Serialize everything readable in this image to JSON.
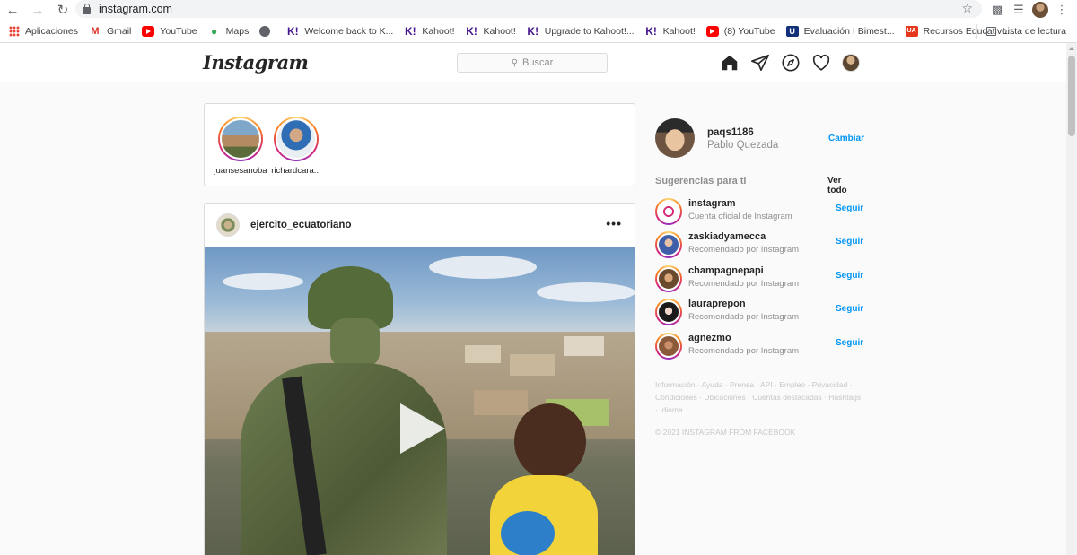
{
  "browser": {
    "url": "instagram.com",
    "bookmarks": [
      {
        "label": "Aplicaciones",
        "icon": "apps-grid-icon"
      },
      {
        "label": "Gmail",
        "icon": "gmail-icon"
      },
      {
        "label": "YouTube",
        "icon": "youtube-icon"
      },
      {
        "label": "Maps",
        "icon": "maps-icon"
      },
      {
        "label": "",
        "icon": "globe-icon"
      },
      {
        "label": "Welcome back to K...",
        "icon": "kahoot-icon"
      },
      {
        "label": "Kahoot!",
        "icon": "kahoot-icon"
      },
      {
        "label": "Kahoot!",
        "icon": "kahoot-icon"
      },
      {
        "label": "Upgrade to Kahoot!...",
        "icon": "kahoot-icon"
      },
      {
        "label": "Kahoot!",
        "icon": "kahoot-icon"
      },
      {
        "label": "(8) YouTube",
        "icon": "youtube-icon"
      },
      {
        "label": "Evaluación I Bimest...",
        "icon": "u-icon"
      },
      {
        "label": "Recursos Educativo...",
        "icon": "ua-icon"
      }
    ],
    "reading_list": "Lista de lectura"
  },
  "header": {
    "logo": "Instagram",
    "search_placeholder": "Buscar"
  },
  "stories": [
    {
      "name": "juansesanoba"
    },
    {
      "name": "richardcara..."
    }
  ],
  "post": {
    "username": "ejercito_ecuatoriano",
    "more": "•••"
  },
  "sidebar": {
    "username": "paqs1186",
    "full_name": "Pablo Quezada",
    "switch": "Cambiar",
    "suggestions_title": "Sugerencias para ti",
    "see_all": "Ver todo",
    "suggestions": [
      {
        "username": "instagram",
        "sub": "Cuenta oficial de Instagram",
        "follow": "Seguir"
      },
      {
        "username": "zaskiadyamecca",
        "sub": "Recomendado por Instagram",
        "follow": "Seguir"
      },
      {
        "username": "champagnepapi",
        "sub": "Recomendado por Instagram",
        "follow": "Seguir"
      },
      {
        "username": "lauraprepon",
        "sub": "Recomendado por Instagram",
        "follow": "Seguir"
      },
      {
        "username": "agnezmo",
        "sub": "Recomendado por Instagram",
        "follow": "Seguir"
      }
    ],
    "footer_links": "Información · Ayuda · Prensa · API · Empleo · Privacidad · Condiciones · Ubicaciones · Cuentas destacadas · Hashtags · Idioma",
    "copyright": "© 2021 INSTAGRAM FROM FACEBOOK"
  },
  "colors": {
    "link_blue": "#0095f6",
    "border": "#dbdbdb",
    "background": "#fafafa"
  }
}
